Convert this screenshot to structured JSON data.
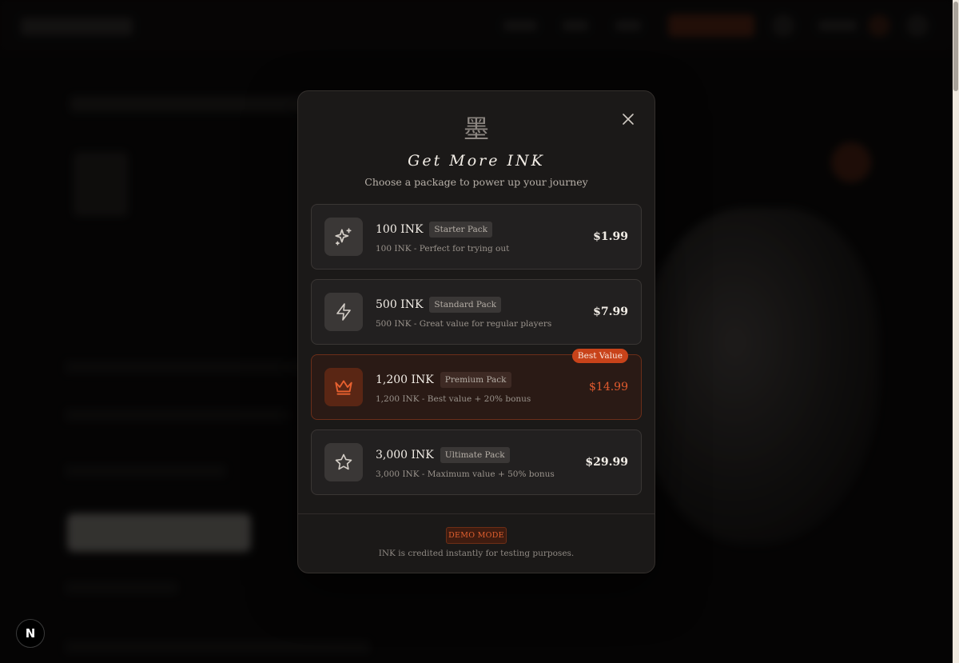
{
  "modal": {
    "kanji": "墨",
    "title": "Get More INK",
    "subtitle": "Choose a package to power up your journey",
    "close_icon": "close-icon",
    "packages": [
      {
        "amount": "100 INK",
        "tag": "Starter Pack",
        "description": "100 INK - Perfect for trying out",
        "price": "$1.99",
        "icon": "sparkles-icon"
      },
      {
        "amount": "500 INK",
        "tag": "Standard Pack",
        "description": "500 INK - Great value for regular players",
        "price": "$7.99",
        "icon": "lightning-icon"
      },
      {
        "amount": "1,200 INK",
        "tag": "Premium Pack",
        "description": "1,200 INK - Best value + 20% bonus",
        "price": "$14.99",
        "icon": "crown-icon",
        "badge": "Best Value",
        "highlighted": true
      },
      {
        "amount": "3,000 INK",
        "tag": "Ultimate Pack",
        "description": "3,000 INK - Maximum value + 50% bonus",
        "price": "$29.99",
        "icon": "star-icon"
      }
    ],
    "demo_badge": "DEMO MODE",
    "demo_note": "INK is credited instantly for testing purposes."
  },
  "corner_badge": "N",
  "colors": {
    "accent": "#c8431a",
    "accent_text": "#e05a2e",
    "modal_bg": "#1b1918",
    "card_bg": "#222020"
  }
}
